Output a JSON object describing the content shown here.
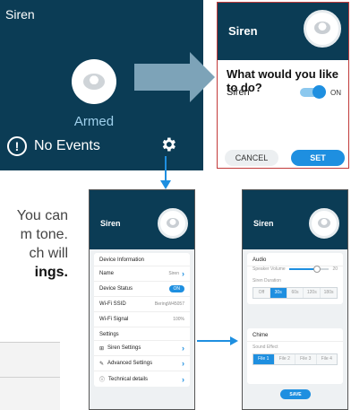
{
  "tile": {
    "title": "Siren",
    "status": "Armed",
    "events": "No Events"
  },
  "dialog": {
    "title": "Siren",
    "question": "What would you like to do?",
    "option_label": "Siren",
    "option_state": "ON",
    "cancel_label": "CANCEL",
    "set_label": "SET"
  },
  "body_text": {
    "line1": "You can",
    "line2": "m tone.",
    "line3": "ch will",
    "line4": "ings."
  },
  "settings_phone": {
    "title": "Siren",
    "device_info_label": "Device Information",
    "rows": [
      {
        "label": "Name",
        "value": "Siren"
      },
      {
        "label": "Device Status",
        "value": "ON"
      },
      {
        "label": "Wi-Fi SSID",
        "value": "BeringW45057"
      },
      {
        "label": "Wi-Fi Signal",
        "value": "100%"
      }
    ],
    "settings_label": "Settings",
    "menu": [
      {
        "label": "Siren Settings"
      },
      {
        "label": "Advanced Settings"
      },
      {
        "label": "Technical details"
      }
    ]
  },
  "siren_settings_phone": {
    "title": "Siren",
    "audio_label": "Audio",
    "volume_label": "Speaker Volume",
    "volume_value": "20",
    "volume_level": 0.7,
    "duration_label": "Siren Duration",
    "durations": [
      "Off",
      "30s",
      "60s",
      "120s",
      "180s"
    ],
    "duration_selected": 1,
    "chime_label": "Chime",
    "effect_label": "Sound Effect",
    "effects": [
      "File 1",
      "File 2",
      "File 3",
      "File 4"
    ],
    "effect_selected": 0,
    "save_label": "SAVE"
  },
  "colors": {
    "navy": "#0b3c55",
    "accent": "#1e8fe0",
    "armed_text": "#9fd0ec"
  }
}
